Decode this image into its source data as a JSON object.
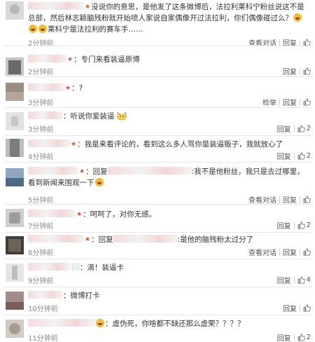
{
  "comments": [
    {
      "text": "没说你的意思，是他发了这条微博后，法拉利莱科宁粉丝说这不是总部，然后林志颖脑残粉就开始喷人家说自家偶像开过法拉利，你们偶像碰过么？",
      "text2": "莱科宁是法拉利的赛车手……",
      "time": "2分钟前",
      "actions": [
        "查看对话",
        "回复"
      ],
      "likes": ""
    },
    {
      "text": "专门来看装逼原博",
      "time": "2分钟前",
      "actions": [
        "回复"
      ],
      "likes": ""
    },
    {
      "text": "?",
      "time": "3分钟前",
      "actions": [
        "检举",
        "回复"
      ],
      "likes": ""
    },
    {
      "text": "听说你爱装逼",
      "time": "3分钟前",
      "actions": [
        "回复"
      ],
      "likes": "2"
    },
    {
      "text": "我是来看评论的，看到这么多人骂你是装逼贩子，我就放心了",
      "time": "4分钟前",
      "actions": [
        "回复"
      ],
      "likes": "2"
    },
    {
      "prefix": "回复",
      "text": ":我不是他粉丝，我只是去过哪里，看到新闻来围观一下",
      "time": "5分钟前",
      "actions": [
        "查看对话",
        "回复"
      ],
      "likes": ""
    },
    {
      "text": "呵呵了，对你无感。",
      "time": "7分钟前",
      "actions": [
        "回复"
      ],
      "likes": "2"
    },
    {
      "prefix": "回复",
      "text": ":是他的脑残粉太过分了",
      "time": "8分钟前",
      "actions": [
        "查看对话",
        "回复"
      ],
      "likes": ""
    },
    {
      "text": "滴！装逼卡",
      "time": "9分钟前",
      "actions": [
        "回复"
      ],
      "likes": "4"
    },
    {
      "text": "微博打卡",
      "time": "10分钟前",
      "actions": [
        "回复"
      ],
      "likes": ""
    },
    {
      "text": "虚伪死，你啥都不缺还那么虚荣？？？？",
      "time": "11分钟前",
      "actions": [
        "回复"
      ],
      "likes": "2"
    }
  ],
  "colors": {
    "link": "#2a6fc1",
    "vip": "#e8502f",
    "time": "#8a8a8a"
  },
  "icons": {
    "vip_badge": "★",
    "like": "thumb-up-icon"
  }
}
